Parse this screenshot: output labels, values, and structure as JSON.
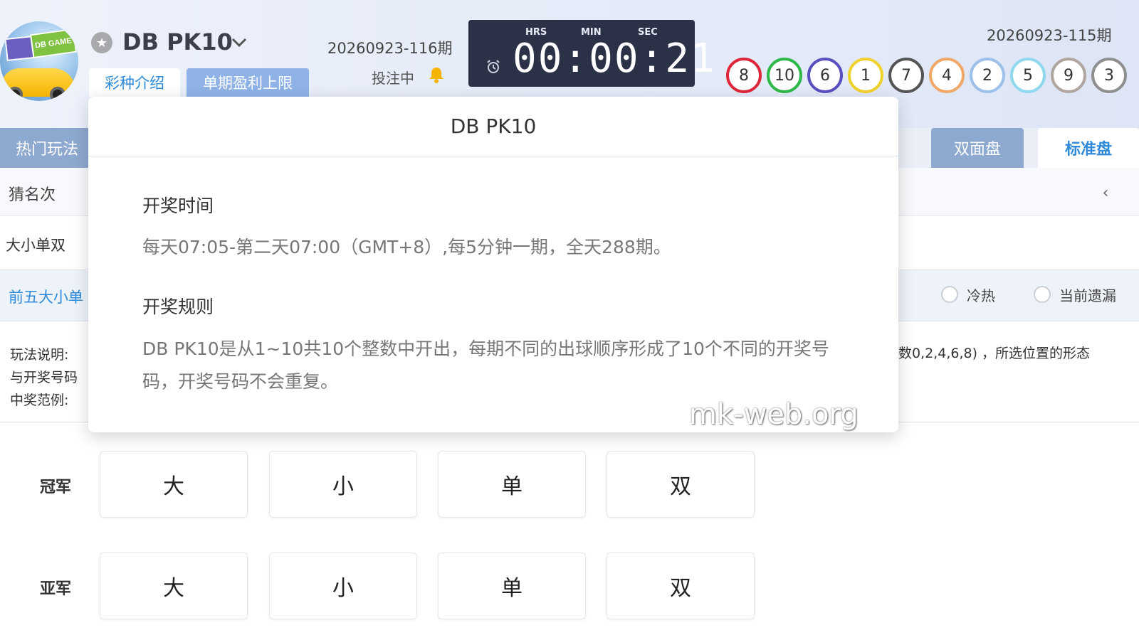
{
  "header": {
    "game_title": "DB PK10",
    "tabs": {
      "intro": "彩种介绍",
      "limit": "单期盈利上限"
    },
    "current_period": "20260923-116期",
    "betting_status": "投注中",
    "countdown": {
      "hrs_label": "HRS",
      "min_label": "MIN",
      "sec_label": "SEC",
      "digits": "00:00:21"
    },
    "previous_period": "20260923-115期",
    "result_balls": [
      {
        "num": "8",
        "color": "#e0263a"
      },
      {
        "num": "10",
        "color": "#2fb84a"
      },
      {
        "num": "6",
        "color": "#5a4fbf"
      },
      {
        "num": "1",
        "color": "#f0d22e"
      },
      {
        "num": "7",
        "color": "#555555"
      },
      {
        "num": "4",
        "color": "#f0a868"
      },
      {
        "num": "2",
        "color": "#9cc0ea"
      },
      {
        "num": "5",
        "color": "#8fd8ee"
      },
      {
        "num": "9",
        "color": "#b0a6a0"
      },
      {
        "num": "3",
        "color": "#8f8f8f"
      }
    ]
  },
  "nav": {
    "hot_tab": "热门玩法",
    "two_side_tab": "双面盘",
    "standard_tab": "标准盘",
    "guess_rank": "猜名次",
    "big_small_odd_even": "大小单双",
    "top5": "前五大小单",
    "cold_hot": "冷热",
    "current_missing": "当前遗漏"
  },
  "rules_partial": {
    "line1": "玩法说明:",
    "line2": "与开奖号码",
    "line3": "中奖范例:",
    "right": "数0,2,4,6,8) ，所选位置的形态"
  },
  "bet_rows": [
    {
      "label": "冠军",
      "options": [
        "大",
        "小",
        "单",
        "双"
      ]
    },
    {
      "label": "亚军",
      "options": [
        "大",
        "小",
        "单",
        "双"
      ]
    }
  ],
  "popup": {
    "title": "DB PK10",
    "draw_time_heading": "开奖时间",
    "draw_time_text": "每天07:05-第二天07:00（GMT+8）,每5分钟一期，全天288期。",
    "draw_rule_heading": "开奖规则",
    "draw_rule_text": "DB PK10是从1~10共10个整数中开出，每期不同的出球顺序形成了10个不同的开奖号码，开奖号码不会重复。"
  },
  "watermark": "mk-web.org",
  "colors": {
    "accent": "#2f8bd9",
    "tab_bg": "#8ea9cf",
    "countdown_bg": "#2b3247"
  }
}
